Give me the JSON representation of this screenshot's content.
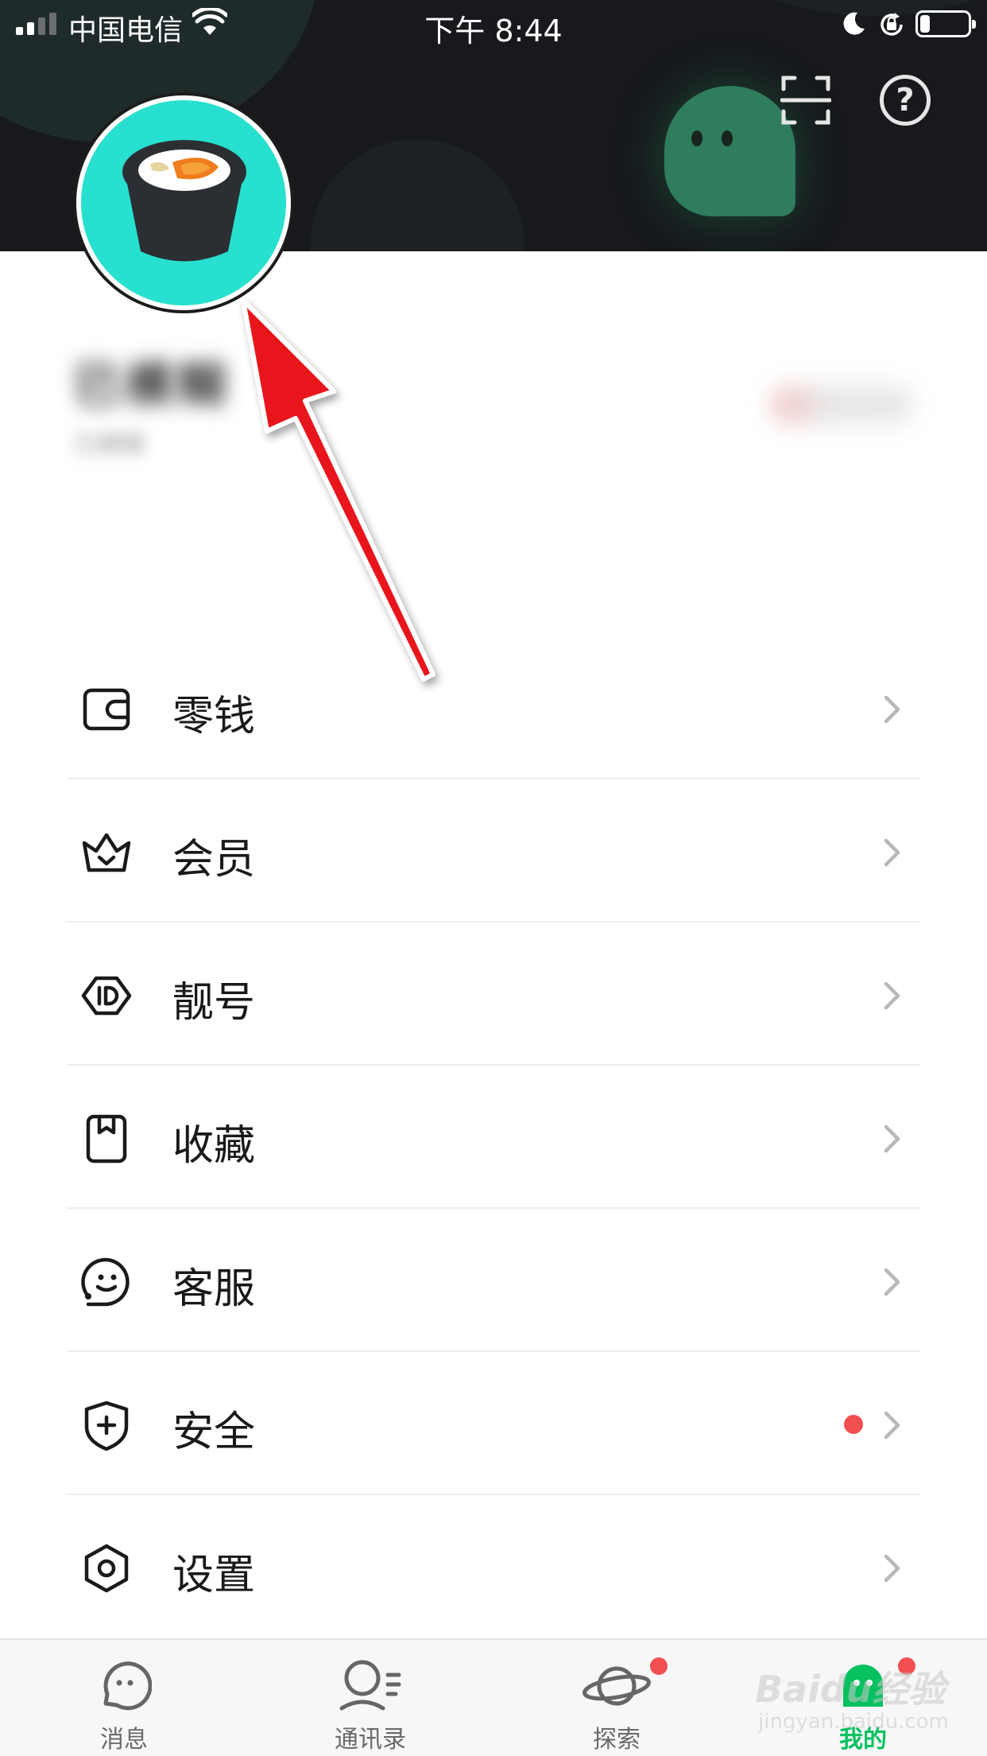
{
  "status_bar": {
    "carrier": "中国电信",
    "time": "下午 8:44",
    "battery_percent": 20
  },
  "header": {
    "scan_icon": "scan-icon",
    "help_icon": "help-icon",
    "help_glyph": "?"
  },
  "profile": {
    "avatar_icon": "sushi-avatar",
    "nickname": "已模糊",
    "account_id": "已模糊"
  },
  "menu": {
    "items": [
      {
        "icon": "wallet-icon",
        "label": "零钱",
        "dot": false
      },
      {
        "icon": "crown-icon",
        "label": "会员",
        "dot": false
      },
      {
        "icon": "id-tag-icon",
        "label": "靓号",
        "dot": false
      },
      {
        "icon": "bookmark-icon",
        "label": "收藏",
        "dot": false
      },
      {
        "icon": "customer-service-icon",
        "label": "客服",
        "dot": false
      },
      {
        "icon": "shield-plus-icon",
        "label": "安全",
        "dot": true
      },
      {
        "icon": "hexagon-settings-icon",
        "label": "设置",
        "dot": false
      }
    ]
  },
  "tab_bar": {
    "tabs": [
      {
        "icon": "chat-bubble-icon",
        "label": "消息",
        "active": false,
        "dot": false
      },
      {
        "icon": "contacts-icon",
        "label": "通讯录",
        "active": false,
        "dot": false
      },
      {
        "icon": "planet-icon",
        "label": "探索",
        "active": false,
        "dot": true
      },
      {
        "icon": "me-icon",
        "label": "我的",
        "active": true,
        "dot": true
      }
    ]
  },
  "watermark": {
    "text": "Baidu经验",
    "sub": "jingyan.baidu.com"
  },
  "colors": {
    "header_bg": "#17191c",
    "avatar_bg": "#27e0cf",
    "accent": "#07c160",
    "badge": "#f24f52",
    "arrow": "#e8141b"
  }
}
